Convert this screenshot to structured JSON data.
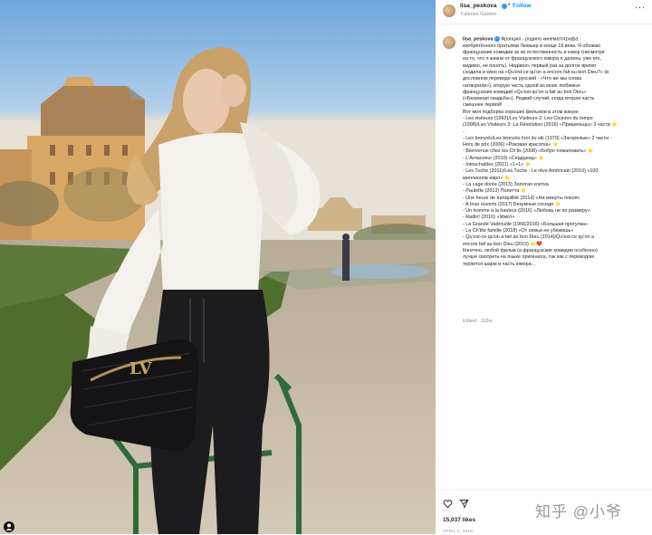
{
  "post": {
    "username": "lisa_peskova",
    "follow_label": "Follow",
    "separator": "•",
    "location": "Tuileries Garden",
    "caption_lines": [
      "Франция - родина кинематографа",
      "изобретённого братьями Люмьер в конце 19 века. Я обожаю",
      "французские комедии за их естественность и юмор (несмотря",
      "на то, что я жизни от французского юмора я далека, уже его,",
      "видимо, не понять). Недавно, первый раз за долгое время",
      "сходила в кино на «Qu'est-ce qu'on a encore fait au bon Dieu?» (в",
      "дословном переводе на русский - «Что же мы снова",
      "натворили»), вторую часть одной из моих любимых",
      "французских комедий «Qu'est qu'on a fait au bon Dieu»",
      "(«Безумная свадьба»). Редкий случай, когда вторая часть",
      "смешнее первой!",
      "Вот моя подборка хороших фильмов в этом жанре:",
      "- Les visiteurs (1993)/Les Visiteurs 2: Les Couloirs du temps",
      "(1998)/Les Visiteurs 3: La Révolution (2016) «Пришельцы» 3 части ⭐",
      "-",
      "- Les bronzés/Les bronzés font du ski (1979) «Загорелые» 2 части -",
      "Hors de prix (2006) «Роковая красотка» ⭐",
      "- Bienvenue chez les Ch'tis (2008) «Бобро пожаловать» ⭐",
      "- L'Arnacoeur (2010) «Сердцеед» ⭐",
      "- Intouchables (2011) «1+1» ⭐",
      "- Les Tuche (2011)/Les Tuche : Le rêve Américain (2016) «100",
      "миллионов евро» ⭐",
      "- La cage dorée (2013) Золотая клетка",
      "- Paulette (2013) Полетта ⭐",
      "- Une heure de tranquillité (2014) «Ни минуты покоя»",
      "- A bras ouverts (2017) Безумные соседи ⭐",
      "- Un homme à la hauteur (2016) «Любовь не по размеру»",
      "- Radin! (2016) «Жмот»",
      "- La Grande Vadrouille (1966/2016) «Большая прогулка»",
      "- La Ch'tite famille (2018) «От семьи не убежишь»",
      "- Qu'est-ce qu'on a fait au bon Dieu (2014)/Qu'est-ce qu'on a",
      "encore fait au bon Dieu (2019) ⭐❤️",
      "Конечно, любой фильм (а французские комедии особенно)",
      "лучше смотреть на языке оригинала, так как с переводом",
      "теряется шарм и часть юмора..."
    ],
    "edited": "Edited · 103w",
    "likes": "15,037 likes",
    "date": "APRIL 2, 2019"
  },
  "watermark": "知乎 @小爷",
  "icons": {
    "like": "heart-icon",
    "share": "share-icon",
    "more": "more-options-icon",
    "verified": "verified-badge-icon",
    "profile": "profile-icon"
  },
  "colors": {
    "link": "#0095f6",
    "text": "#262626",
    "muted": "#8e8e8e",
    "verified": "#3897f0"
  }
}
